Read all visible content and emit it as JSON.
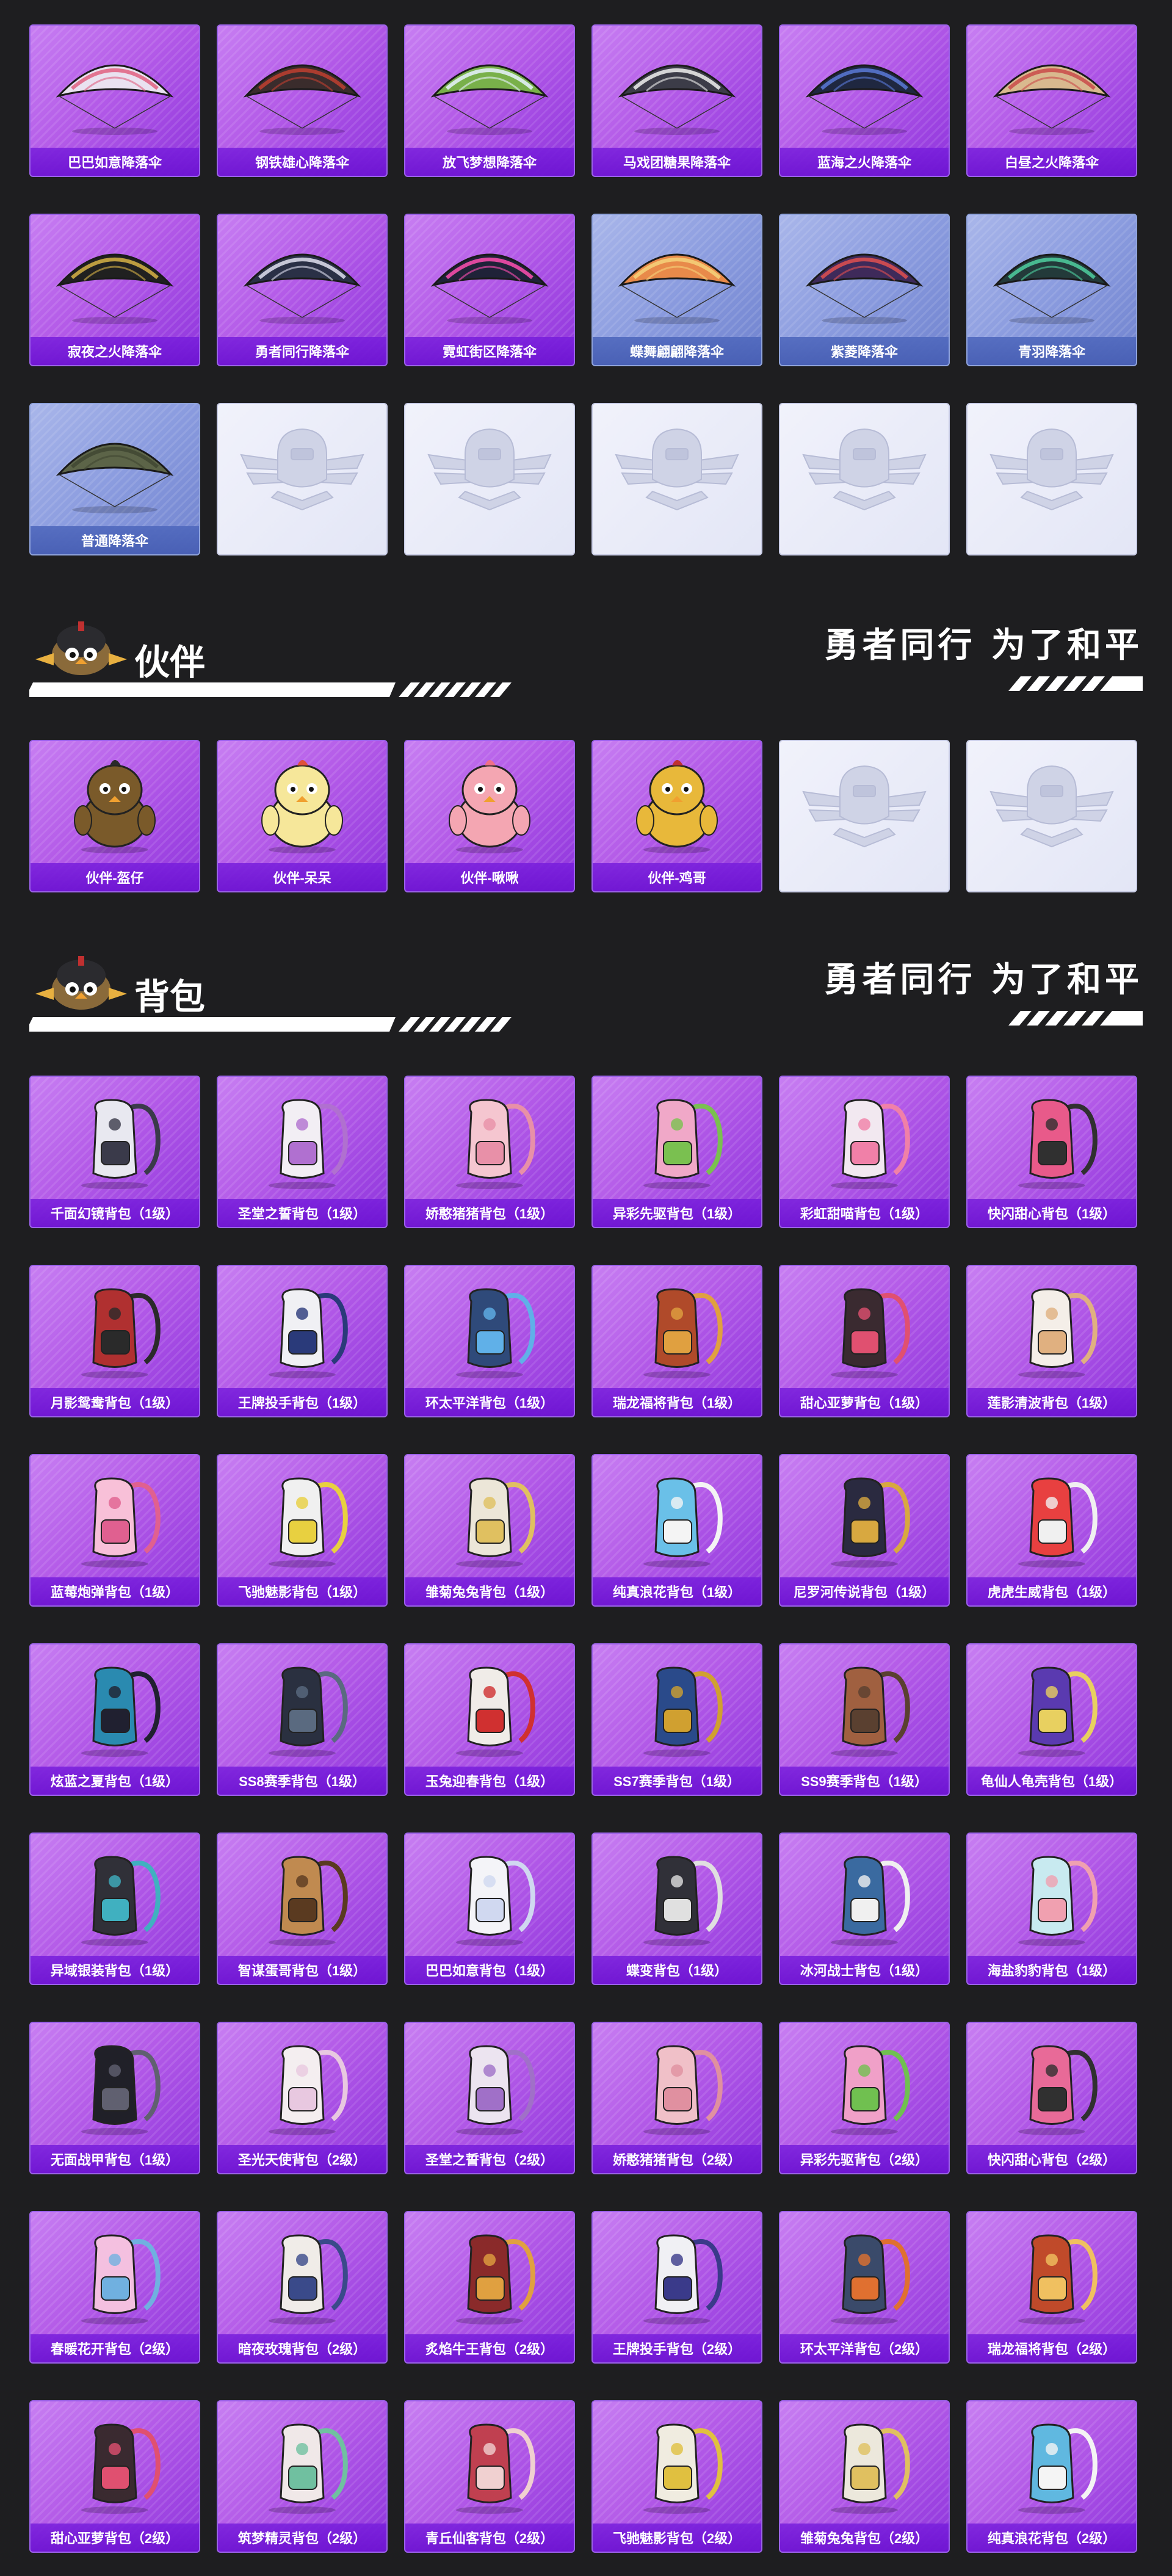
{
  "parachutes": [
    {
      "label": "巴巴如意降落伞",
      "style": "purple",
      "color": "#e9e2f0",
      "accent": "#e06080"
    },
    {
      "label": "钢铁雄心降落伞",
      "style": "purple",
      "color": "#3a2c2c",
      "accent": "#c04030"
    },
    {
      "label": "放飞梦想降落伞",
      "style": "purple",
      "color": "#79b04a",
      "accent": "#e8f3ff"
    },
    {
      "label": "马戏团糖果降落伞",
      "style": "purple",
      "color": "#3c3c48",
      "accent": "#f0f0f0"
    },
    {
      "label": "蓝海之火降落伞",
      "style": "purple",
      "color": "#1f2740",
      "accent": "#5a7ad8"
    },
    {
      "label": "白昼之火降落伞",
      "style": "purple",
      "color": "#d9b98f",
      "accent": "#c94a4a"
    },
    {
      "label": "寂夜之火降落伞",
      "style": "purple",
      "color": "#202020",
      "accent": "#d7b347"
    },
    {
      "label": "勇者同行降落伞",
      "style": "purple",
      "color": "#2a3046",
      "accent": "#e0e0f0"
    },
    {
      "label": "霓虹街区降落伞",
      "style": "purple",
      "color": "#1f2238",
      "accent": "#ff4fb0"
    },
    {
      "label": "蝶舞翩翩降落伞",
      "style": "blue",
      "color": "#e88a4a",
      "accent": "#f5d27a"
    },
    {
      "label": "紫菱降落伞",
      "style": "blue",
      "color": "#3e2a5a",
      "accent": "#e05050"
    },
    {
      "label": "青羽降落伞",
      "style": "blue",
      "color": "#233a3a",
      "accent": "#4fd0a0"
    },
    {
      "label": "普通降落伞",
      "style": "blue",
      "color": "#5c6448",
      "accent": "#3f4632"
    },
    {
      "label": "",
      "style": "empty"
    },
    {
      "label": "",
      "style": "empty"
    },
    {
      "label": "",
      "style": "empty"
    },
    {
      "label": "",
      "style": "empty"
    },
    {
      "label": "",
      "style": "empty"
    }
  ],
  "companion_section": {
    "title": "伙伴",
    "slogan": "勇者同行 为了和平"
  },
  "companions": [
    {
      "label": "伙伴-盔仔",
      "style": "purple",
      "color": "#7a5a2a",
      "accent": "#2a2a2a"
    },
    {
      "label": "伙伴-呆呆",
      "style": "purple",
      "color": "#f6e79a",
      "accent": "#e0503a"
    },
    {
      "label": "伙伴-啾啾",
      "style": "purple",
      "color": "#f4a6b2",
      "accent": "#f07088"
    },
    {
      "label": "伙伴-鸡哥",
      "style": "purple",
      "color": "#e8b83a",
      "accent": "#c03030"
    },
    {
      "label": "",
      "style": "empty"
    },
    {
      "label": "",
      "style": "empty"
    }
  ],
  "backpack_section": {
    "title": "背包",
    "slogan": "勇者同行 为了和平"
  },
  "backpacks": [
    {
      "label": "千面幻镜背包（1级）",
      "style": "purple",
      "color": "#e8e8f0",
      "accent": "#3a3a4a"
    },
    {
      "label": "圣堂之誓背包（1级）",
      "style": "purple",
      "color": "#f2eef4",
      "accent": "#b070d0"
    },
    {
      "label": "娇憨猪猪背包（1级）",
      "style": "purple",
      "color": "#f5c6d0",
      "accent": "#e890a8"
    },
    {
      "label": "异彩先驱背包（1级）",
      "style": "purple",
      "color": "#f0a8c8",
      "accent": "#7ac050"
    },
    {
      "label": "彩虹甜喵背包（1级）",
      "style": "purple",
      "color": "#f2e8f0",
      "accent": "#f080a8"
    },
    {
      "label": "快闪甜心背包（1级）",
      "style": "purple",
      "color": "#e85a8a",
      "accent": "#303030"
    },
    {
      "label": "月影鸳鸯背包（1级）",
      "style": "purple",
      "color": "#b03030",
      "accent": "#2a2a2a"
    },
    {
      "label": "王牌投手背包（1级）",
      "style": "purple",
      "color": "#f0f0f4",
      "accent": "#2a3a7a"
    },
    {
      "label": "环太平洋背包（1级）",
      "style": "purple",
      "color": "#2f4a7a",
      "accent": "#60b0e8"
    },
    {
      "label": "瑞龙福将背包（1级）",
      "style": "purple",
      "color": "#b04a2a",
      "accent": "#e0a040"
    },
    {
      "label": "甜心亚萝背包（1级）",
      "style": "purple",
      "color": "#3a2a30",
      "accent": "#e05070"
    },
    {
      "label": "莲影清波背包（1级）",
      "style": "purple",
      "color": "#f4eee8",
      "accent": "#e0b080"
    },
    {
      "label": "蓝莓炮弹背包（1级）",
      "style": "purple",
      "color": "#f8c0d8",
      "accent": "#e06090"
    },
    {
      "label": "飞驰魅影背包（1级）",
      "style": "purple",
      "color": "#f0f0f0",
      "accent": "#e8d040"
    },
    {
      "label": "雏菊兔兔背包（1级）",
      "style": "purple",
      "color": "#ece6d8",
      "accent": "#e0c060"
    },
    {
      "label": "纯真浪花背包（1级）",
      "style": "purple",
      "color": "#6ac0e8",
      "accent": "#f4f4f4"
    },
    {
      "label": "尼罗河传说背包（1级）",
      "style": "purple",
      "color": "#2a2a40",
      "accent": "#d8a840"
    },
    {
      "label": "虎虎生威背包（1级）",
      "style": "purple",
      "color": "#e84040",
      "accent": "#f0f0f0"
    },
    {
      "label": "炫蓝之夏背包（1级）",
      "style": "purple",
      "color": "#2a8ab0",
      "accent": "#202030"
    },
    {
      "label": "SS8赛季背包（1级）",
      "style": "purple",
      "color": "#2a3040",
      "accent": "#5a6a80"
    },
    {
      "label": "玉兔迎春背包（1级）",
      "style": "purple",
      "color": "#f0ece8",
      "accent": "#d03030"
    },
    {
      "label": "SS7赛季背包（1级）",
      "style": "purple",
      "color": "#2a4a8a",
      "accent": "#d0a030"
    },
    {
      "label": "SS9赛季背包（1级）",
      "style": "purple",
      "color": "#a06040",
      "accent": "#5a4030"
    },
    {
      "label": "龟仙人龟壳背包（1级）",
      "style": "purple",
      "color": "#5a3ab0",
      "accent": "#e8d060"
    },
    {
      "label": "异域银装背包（1级）",
      "style": "purple",
      "color": "#303038",
      "accent": "#40b0c0"
    },
    {
      "label": "智谋蛋哥背包（1级）",
      "style": "purple",
      "color": "#c08a50",
      "accent": "#5a3a20"
    },
    {
      "label": "巴巴如意背包（1级）",
      "style": "purple",
      "color": "#f4f4f8",
      "accent": "#d0d8f0"
    },
    {
      "label": "蝶变背包（1级）",
      "style": "purple",
      "color": "#303038",
      "accent": "#e0e0e0"
    },
    {
      "label": "冰河战士背包（1级）",
      "style": "purple",
      "color": "#3a6aa0",
      "accent": "#f0f0f0"
    },
    {
      "label": "海盐豹豹背包（1级）",
      "style": "purple",
      "color": "#c8eaf0",
      "accent": "#f0a0b0"
    },
    {
      "label": "无面战甲背包（1级）",
      "style": "purple",
      "color": "#202028",
      "accent": "#606070"
    },
    {
      "label": "圣光天使背包（2级）",
      "style": "purple",
      "color": "#f4eef0",
      "accent": "#e8c8e0"
    },
    {
      "label": "圣堂之誓背包（2级）",
      "style": "purple",
      "color": "#ece4f0",
      "accent": "#a070c8"
    },
    {
      "label": "娇憨猪猪背包（2级）",
      "style": "purple",
      "color": "#f0c0c8",
      "accent": "#e090a0"
    },
    {
      "label": "异彩先驱背包（2级）",
      "style": "purple",
      "color": "#f0a0c8",
      "accent": "#70c050"
    },
    {
      "label": "快闪甜心背包（2级）",
      "style": "purple",
      "color": "#e86a98",
      "accent": "#303030"
    },
    {
      "label": "春暖花开背包（2级）",
      "style": "purple",
      "color": "#f4c0e0",
      "accent": "#70b0e0"
    },
    {
      "label": "暗夜玫瑰背包（2级）",
      "style": "purple",
      "color": "#f0ece8",
      "accent": "#3a4a8a"
    },
    {
      "label": "炙焰牛王背包（2级）",
      "style": "purple",
      "color": "#8a2a2a",
      "accent": "#e0a040"
    },
    {
      "label": "王牌投手背包（2级）",
      "style": "purple",
      "color": "#f0f0f4",
      "accent": "#3a3a8a"
    },
    {
      "label": "环太平洋背包（2级）",
      "style": "purple",
      "color": "#3a4a6a",
      "accent": "#e07030"
    },
    {
      "label": "瑞龙福将背包（2级）",
      "style": "purple",
      "color": "#c04a2a",
      "accent": "#f0c060"
    },
    {
      "label": "甜心亚萝背包（2级）",
      "style": "purple",
      "color": "#3a2a30",
      "accent": "#e05070"
    },
    {
      "label": "筑梦精灵背包（2级）",
      "style": "purple",
      "color": "#f0e8e8",
      "accent": "#70c0a0"
    },
    {
      "label": "青丘仙客背包（2级）",
      "style": "purple",
      "color": "#c04050",
      "accent": "#f0d0d0"
    },
    {
      "label": "飞驰魅影背包（2级）",
      "style": "purple",
      "color": "#f0ece0",
      "accent": "#e0c040"
    },
    {
      "label": "雏菊兔兔背包（2级）",
      "style": "purple",
      "color": "#ece8dc",
      "accent": "#e0c060"
    },
    {
      "label": "纯真浪花背包（2级）",
      "style": "purple",
      "color": "#60b8e0",
      "accent": "#f4f4f4"
    }
  ]
}
